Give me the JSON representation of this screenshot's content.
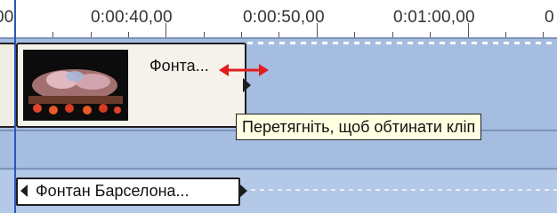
{
  "ruler": {
    "labels": [
      "00",
      "0:00:40,00",
      "0:00:50,00",
      "0:01:00,00",
      "0"
    ]
  },
  "timeline": {
    "clip": {
      "name": "Фонта..."
    },
    "tooltip": "Перетягніть, щоб обтинати кліп",
    "title_clip": {
      "name": "Фонтан Барселона..."
    }
  },
  "colors": {
    "track_bg": "#a6bde2",
    "playhead": "#2a56b8",
    "trim_arrow": "#e01e1e",
    "tooltip_bg": "#ffffe1"
  },
  "icons": {
    "trim": "double-headed-arrow-icon"
  }
}
